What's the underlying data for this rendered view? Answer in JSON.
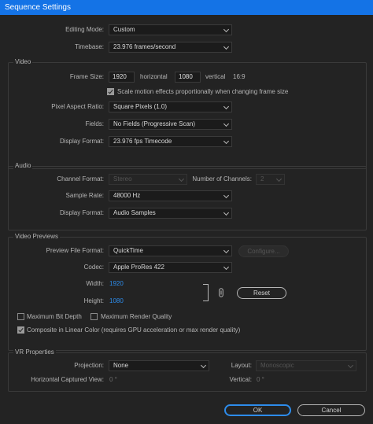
{
  "window": {
    "title": "Sequence Settings"
  },
  "general": {
    "editing_mode_label": "Editing Mode:",
    "editing_mode_value": "Custom",
    "timebase_label": "Timebase:",
    "timebase_value": "23.976  frames/second"
  },
  "video": {
    "legend": "Video",
    "frame_size_label": "Frame Size:",
    "frame_width": "1920",
    "horizontal_label": "horizontal",
    "frame_height": "1080",
    "vertical_label": "vertical",
    "aspect_label": "16:9",
    "scale_motion_label": "Scale motion effects proportionally when changing frame size",
    "pixel_aspect_label": "Pixel Aspect Ratio:",
    "pixel_aspect_value": "Square Pixels (1.0)",
    "fields_label": "Fields:",
    "fields_value": "No Fields (Progressive Scan)",
    "display_format_label": "Display Format:",
    "display_format_value": "23.976 fps Timecode"
  },
  "audio": {
    "legend": "Audio",
    "channel_format_label": "Channel Format:",
    "channel_format_value": "Stereo",
    "num_channels_label": "Number of Channels:",
    "num_channels_value": "2",
    "sample_rate_label": "Sample Rate:",
    "sample_rate_value": "48000 Hz",
    "display_format_label": "Display Format:",
    "display_format_value": "Audio Samples"
  },
  "previews": {
    "legend": "Video Previews",
    "file_format_label": "Preview File Format:",
    "file_format_value": "QuickTime",
    "configure_label": "Configure...",
    "codec_label": "Codec:",
    "codec_value": "Apple ProRes 422",
    "width_label": "Width:",
    "width_value": "1920",
    "height_label": "Height:",
    "height_value": "1080",
    "reset_label": "Reset",
    "max_bit_depth_label": "Maximum Bit Depth",
    "max_render_quality_label": "Maximum Render Quality",
    "composite_linear_label": "Composite in Linear Color (requires GPU acceleration or max render quality)"
  },
  "vr": {
    "legend": "VR Properties",
    "projection_label": "Projection:",
    "projection_value": "None",
    "layout_label": "Layout:",
    "layout_value": "Monoscopic",
    "h_captured_label": "Horizontal Captured View:",
    "h_captured_value": "0 °",
    "vertical_label": "Vertical:",
    "vertical_value": "0 °"
  },
  "footer": {
    "ok_label": "OK",
    "cancel_label": "Cancel"
  },
  "checkboxes": {
    "scale_motion": true,
    "max_bit_depth": false,
    "max_render_quality": false,
    "composite_linear": true
  },
  "colors": {
    "accent": "#1473e6",
    "link_blue": "#2d8ceb",
    "background": "#232323"
  }
}
